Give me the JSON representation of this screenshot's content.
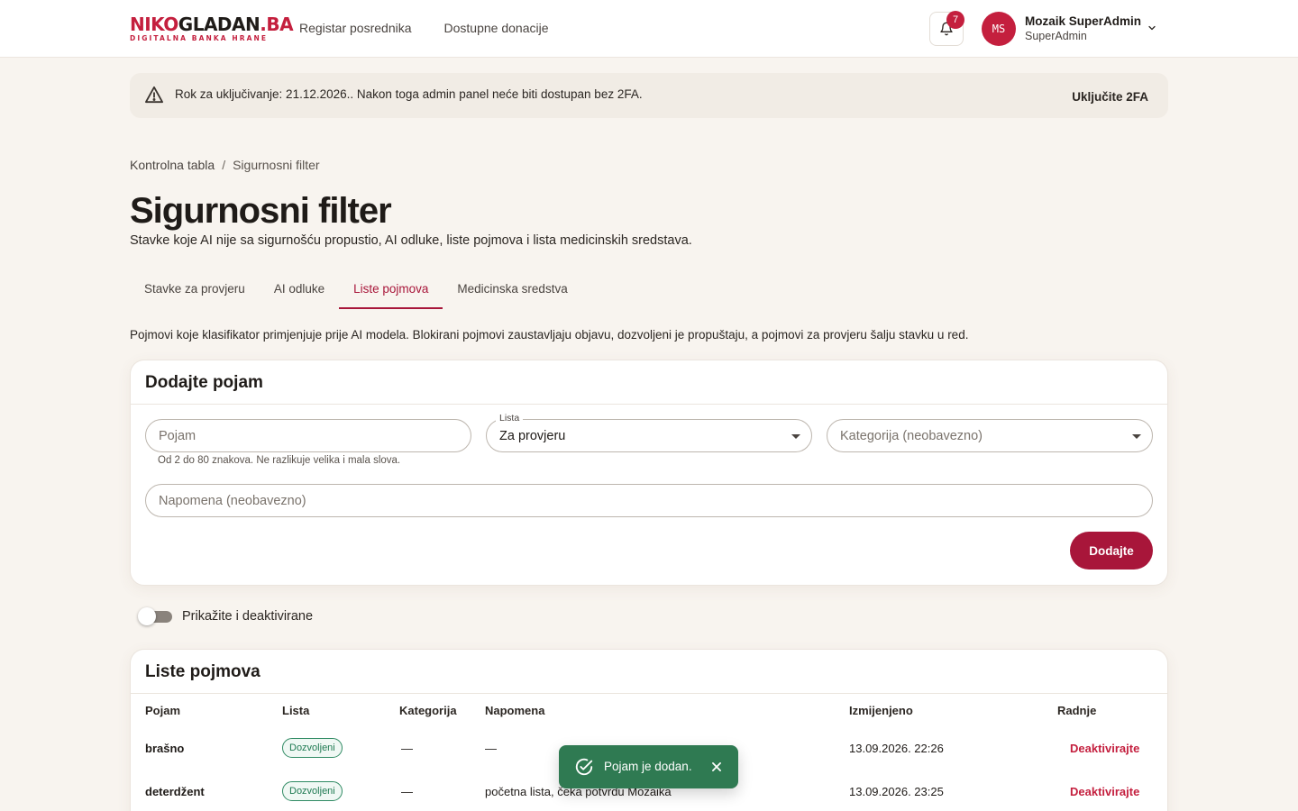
{
  "header": {
    "logo_main_part1": "NIKO",
    "logo_main_part2": "GLADAN",
    "logo_main_part3": ".BA",
    "logo_sub": "DIGITALNA BANKA HRANE",
    "nav": [
      "Registar posrednika",
      "Dostupne donacije"
    ],
    "notifications_count": "7",
    "avatar_initials": "MS",
    "user_name": "Mozaik SuperAdmin",
    "user_role": "SuperAdmin"
  },
  "alert": {
    "text": "Rok za uključivanje: 21.12.2026.. Nakon toga admin panel neće biti dostupan bez 2FA.",
    "action": "Uključite 2FA"
  },
  "breadcrumb": {
    "root": "Kontrolna tabla",
    "separator": "/",
    "current": "Sigurnosni filter"
  },
  "page": {
    "title": "Sigurnosni filter",
    "subtitle": "Stavke koje AI nije sa sigurnošću propustio, AI odluke, liste pojmova i lista medicinskih sredstava.",
    "intro": "Pojmovi koje klasifikator primjenjuje prije AI modela. Blokirani pojmovi zaustavljaju objavu, dozvoljeni je propuštaju, a pojmovi za provjeru šalju stavku u red."
  },
  "tabs": [
    {
      "label": "Stavke za provjeru",
      "active": false
    },
    {
      "label": "AI odluke",
      "active": false
    },
    {
      "label": "Liste pojmova",
      "active": true
    },
    {
      "label": "Medicinska sredstva",
      "active": false
    }
  ],
  "add_form": {
    "title": "Dodajte pojam",
    "term_placeholder": "Pojam",
    "term_hint": "Od 2 do 80 znakova. Ne razlikuje velika i mala slova.",
    "list_label": "Lista",
    "list_value": "Za provjeru",
    "category_placeholder": "Kategorija (neobavezno)",
    "note_placeholder": "Napomena (neobavezno)",
    "submit_label": "Dodajte"
  },
  "toggle": {
    "label": "Prikažite i deaktivirane",
    "on": false
  },
  "list": {
    "title": "Liste pojmova",
    "columns": [
      "Pojam",
      "Lista",
      "Kategorija",
      "Napomena",
      "Izmijenjeno",
      "Radnje"
    ],
    "rows": [
      {
        "term": "brašno",
        "list": "Dozvoljeni",
        "category": "—",
        "note": "—",
        "modified": "13.09.2026. 22:26",
        "action": "Deaktivirajte"
      },
      {
        "term": "deterdžent",
        "list": "Dozvoljeni",
        "category": "—",
        "note": "početna lista, čeka potvrdu Mozaika",
        "modified": "13.09.2026. 23:25",
        "action": "Deaktivirajte"
      }
    ]
  },
  "toast": {
    "text": "Pojam je dodan."
  },
  "colors": {
    "accent": "#a8163a",
    "brand_red": "#c41f3e",
    "success": "#2f7a52",
    "background": "#f8f4ef"
  }
}
